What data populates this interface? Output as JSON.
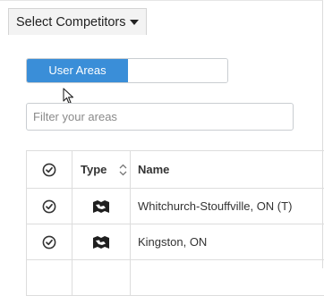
{
  "select_competitors": {
    "label": "Select Competitors"
  },
  "toggle": {
    "active_label": "User Areas",
    "inactive_label": ""
  },
  "filter": {
    "placeholder": "Filter your areas",
    "value": ""
  },
  "table": {
    "headers": {
      "type": "Type",
      "name": "Name"
    },
    "rows": [
      {
        "type_icon": "map-icon",
        "name": "Whitchurch-Stouffville, ON (T)"
      },
      {
        "type_icon": "map-icon",
        "name": "Kingston, ON"
      }
    ]
  },
  "colors": {
    "accent": "#3a8ed8",
    "border": "#dddddd"
  }
}
